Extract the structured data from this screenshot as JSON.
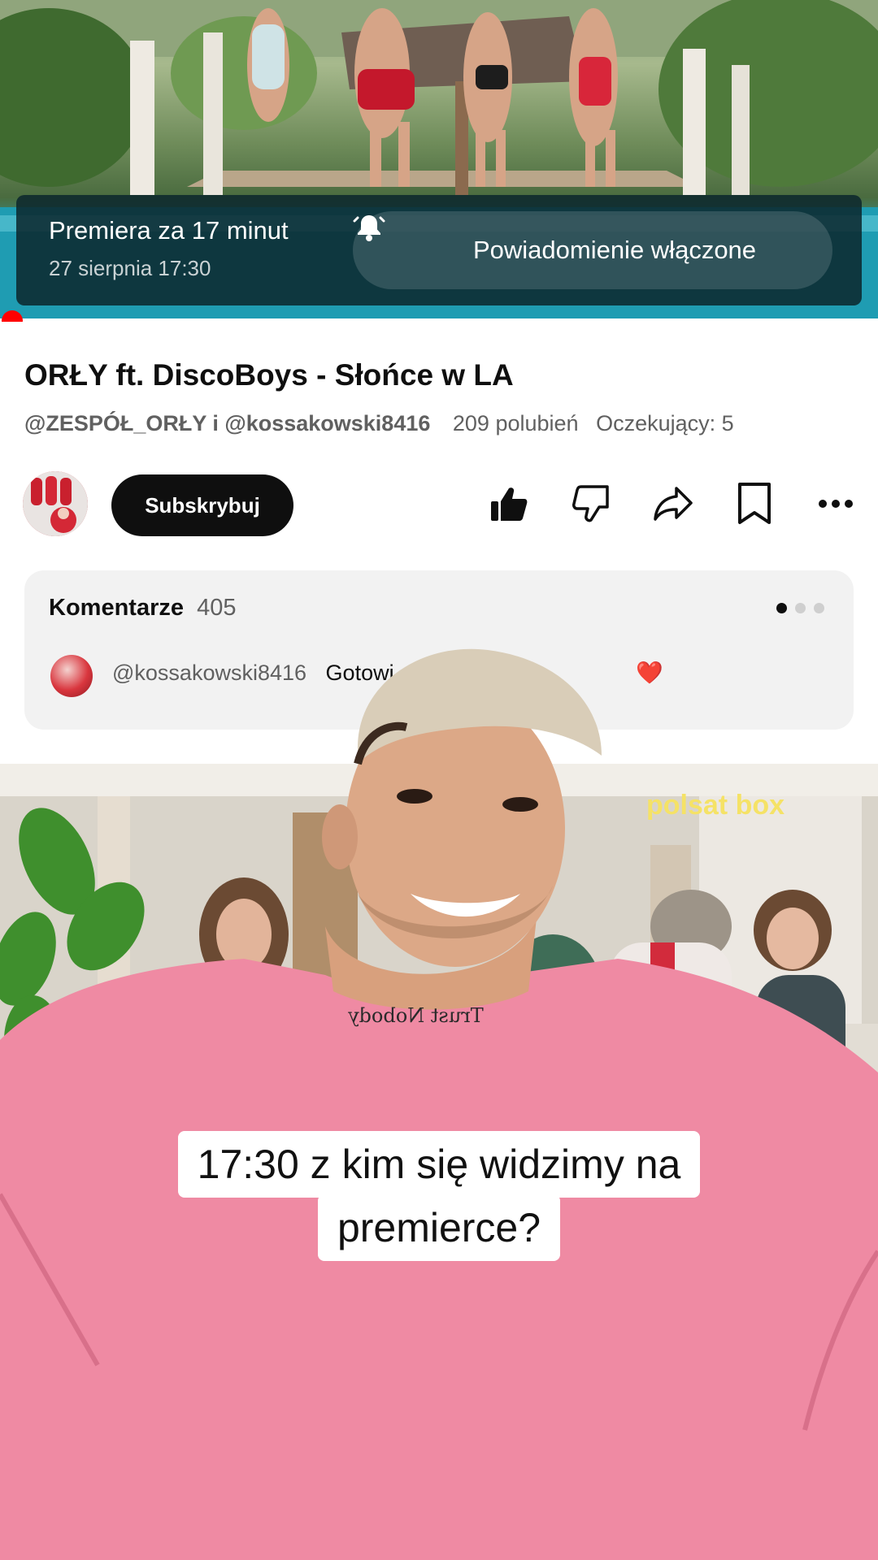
{
  "premiere": {
    "title": "Premiera za 17 minut",
    "date": "27 sierpnia 17:30",
    "notify_label": "Powiadomienie włączone"
  },
  "video": {
    "title": "ORŁY ft. DiscoBoys - Słońce w LA",
    "channels": "@ZESPÓŁ_ORŁY i @kossakowski8416",
    "likes": "209 polubień",
    "waiting": "Oczekujący: 5"
  },
  "actions": {
    "subscribe_label": "Subskrybuj",
    "icons": [
      "thumbs-up-icon",
      "thumbs-down-icon",
      "share-icon",
      "save-icon",
      "more-icon"
    ]
  },
  "comments": {
    "label": "Komentarze",
    "count": "405",
    "author": "@kossakowski8416",
    "text": "Gotowi",
    "emoji": "❤️",
    "page_indicator_active": 0,
    "page_indicator_total": 3
  },
  "overlay": {
    "watermark": "polsat box",
    "shirt_text": "Trust Nobody",
    "caption_line1": "17:30 z kim się widzimy na",
    "caption_line2": "premierce?"
  },
  "colors": {
    "accent_red": "#ff0000",
    "subscribe_bg": "#0f0f0f",
    "shirt_pink": "#ef8aa3"
  }
}
